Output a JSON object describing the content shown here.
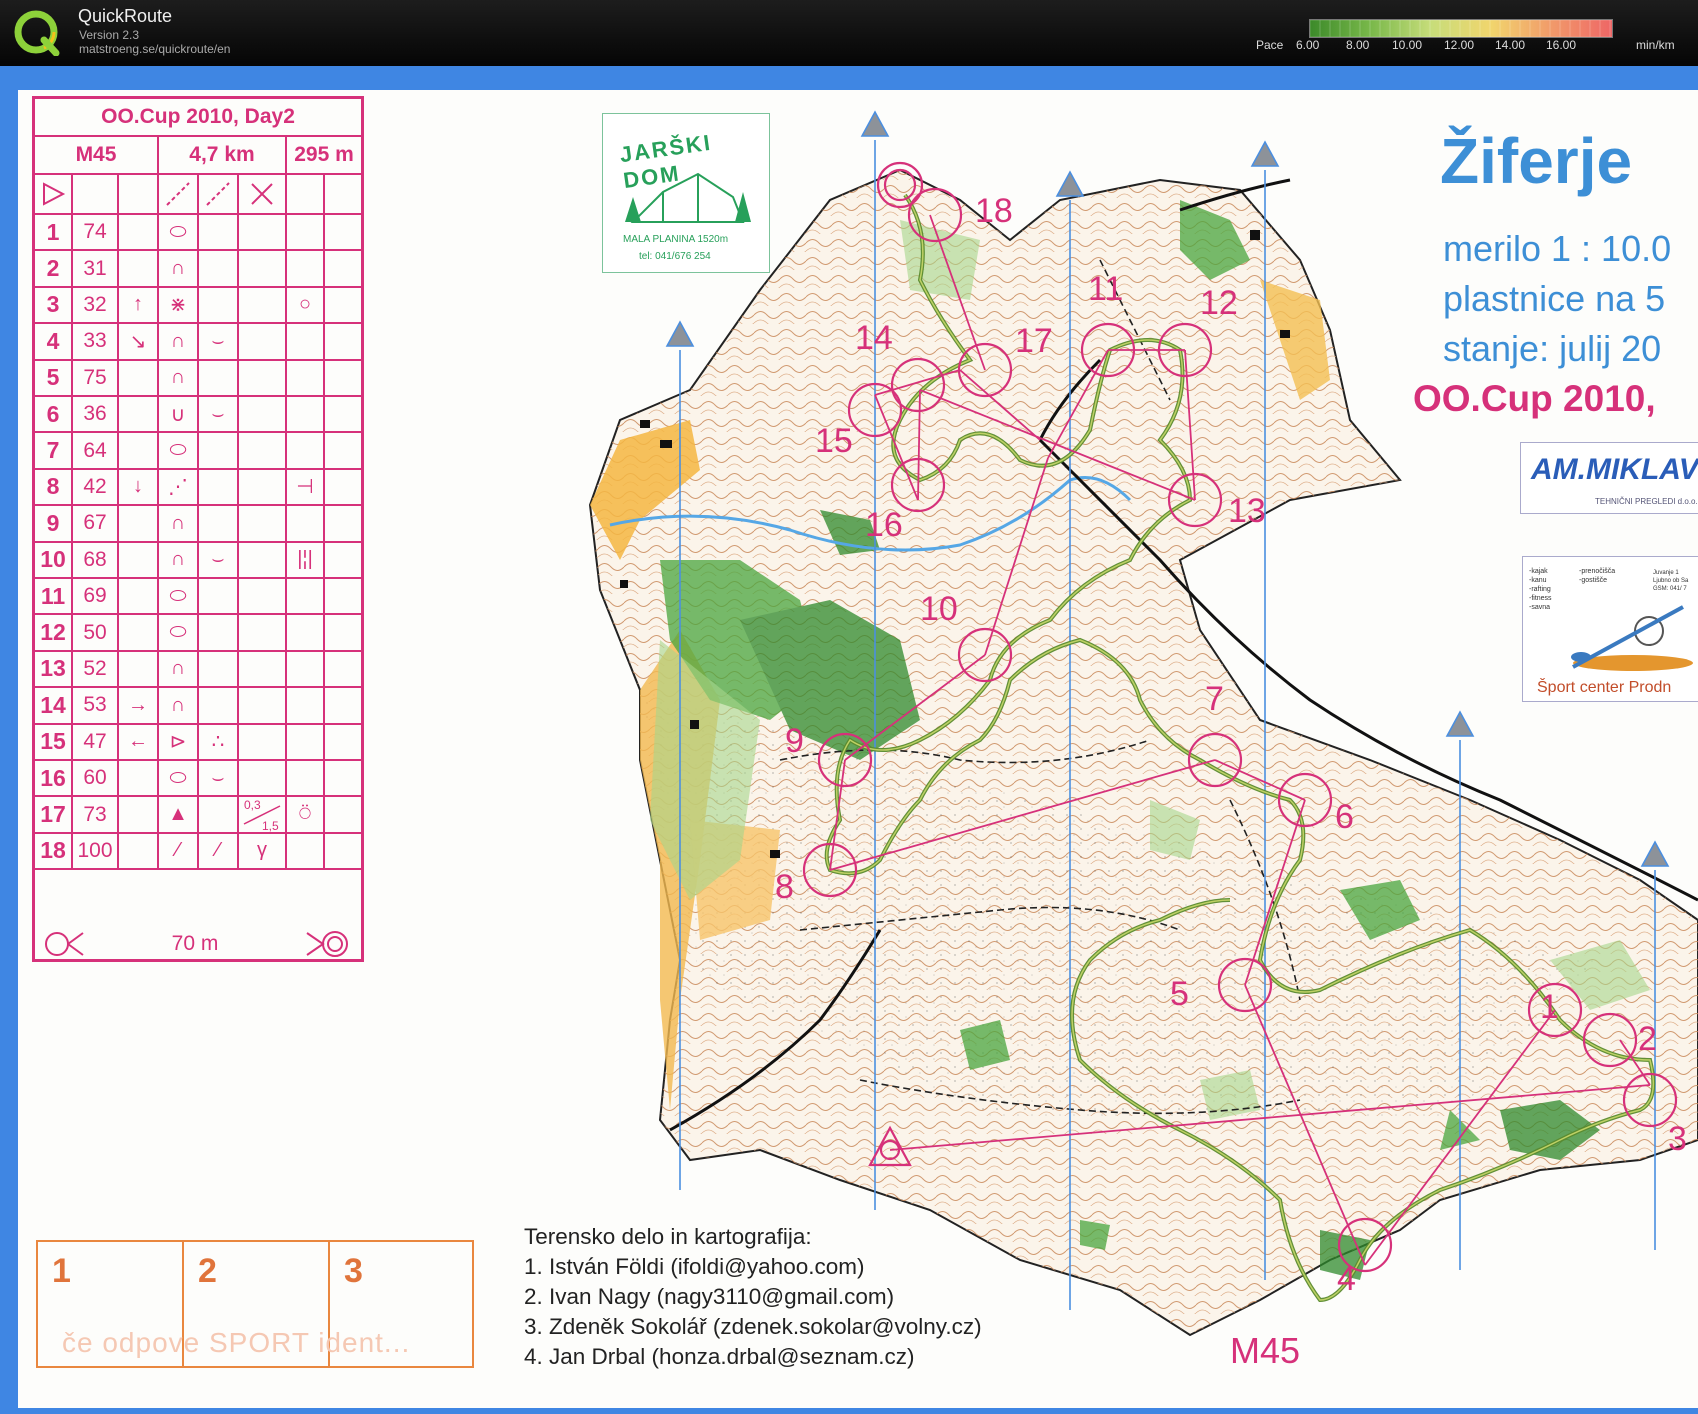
{
  "app": {
    "title": "QuickRoute",
    "version": "Version 2.3",
    "url": "matstroeng.se/quickroute/en"
  },
  "pace_scale": {
    "label": "Pace",
    "ticks": [
      "6.00",
      "8.00",
      "10.00",
      "12.00",
      "14.00",
      "16.00"
    ],
    "unit": "min/km"
  },
  "description": {
    "event": "OO.Cup 2010, Day2",
    "class": "M45",
    "length": "4,7 km",
    "climb": "295 m",
    "controls": [
      {
        "n": "1",
        "code": "74"
      },
      {
        "n": "2",
        "code": "31"
      },
      {
        "n": "3",
        "code": "32"
      },
      {
        "n": "4",
        "code": "33"
      },
      {
        "n": "5",
        "code": "75"
      },
      {
        "n": "6",
        "code": "36"
      },
      {
        "n": "7",
        "code": "64"
      },
      {
        "n": "8",
        "code": "42"
      },
      {
        "n": "9",
        "code": "67"
      },
      {
        "n": "10",
        "code": "68"
      },
      {
        "n": "11",
        "code": "69"
      },
      {
        "n": "12",
        "code": "50"
      },
      {
        "n": "13",
        "code": "52"
      },
      {
        "n": "14",
        "code": "53"
      },
      {
        "n": "15",
        "code": "47"
      },
      {
        "n": "16",
        "code": "60"
      },
      {
        "n": "17",
        "code": "73"
      },
      {
        "n": "18",
        "code": "100"
      }
    ],
    "dim_top": "0,3",
    "dim_bottom": "1,5",
    "finish_distance": "70 m"
  },
  "punch_boxes": {
    "labels": [
      "1",
      "2",
      "3"
    ],
    "note": "če odpove SPORT ident..."
  },
  "credits": {
    "heading": "Terensko delo in kartografija:",
    "lines": [
      "1. István Földi (ifoldi@yahoo.com)",
      "2. Ivan Nagy (nagy3110@gmail.com)",
      "3. Zdeněk Sokolář (zdenek.sokolar@volny.cz)",
      "4. Jan Drbal (honza.drbal@seznam.cz)"
    ]
  },
  "class_label": "M45",
  "map_info": {
    "name": "Žiferje",
    "scale": "merilo 1 : 10.0",
    "contours": "plastnice na 5",
    "state": "stanje: julij 20",
    "event": "OO.Cup 2010,"
  },
  "sponsors": {
    "jarski": {
      "name": "JARŠKI DOM",
      "sub": "MALA PLANINA 1520m",
      "tel": "tel: 041/676 254"
    },
    "miklav": {
      "name": "AM.MIKLAV",
      "sub": "TEHNIČNI PREGLEDI d.o.o."
    },
    "sport": {
      "name": "Šport center Prodn",
      "list1": [
        "-kajak",
        "-kanu",
        "-rafting",
        "-fitness",
        "-savna"
      ],
      "list2": [
        "-prenočišča",
        "-gostišče"
      ],
      "addr": [
        "Juvanje 1",
        "Ljubno ob Sa",
        "GSM: 041/ 7"
      ]
    }
  },
  "course_numbers": [
    "18",
    "14",
    "17",
    "11",
    "12",
    "15",
    "16",
    "13",
    "10",
    "9",
    "7",
    "6",
    "8",
    "5",
    "1",
    "2",
    "3",
    "4"
  ],
  "colors": {
    "course": "#d6317a",
    "route": "#5a8a2e",
    "frame": "#3f86e3",
    "meridian": "#4b8fe0"
  }
}
